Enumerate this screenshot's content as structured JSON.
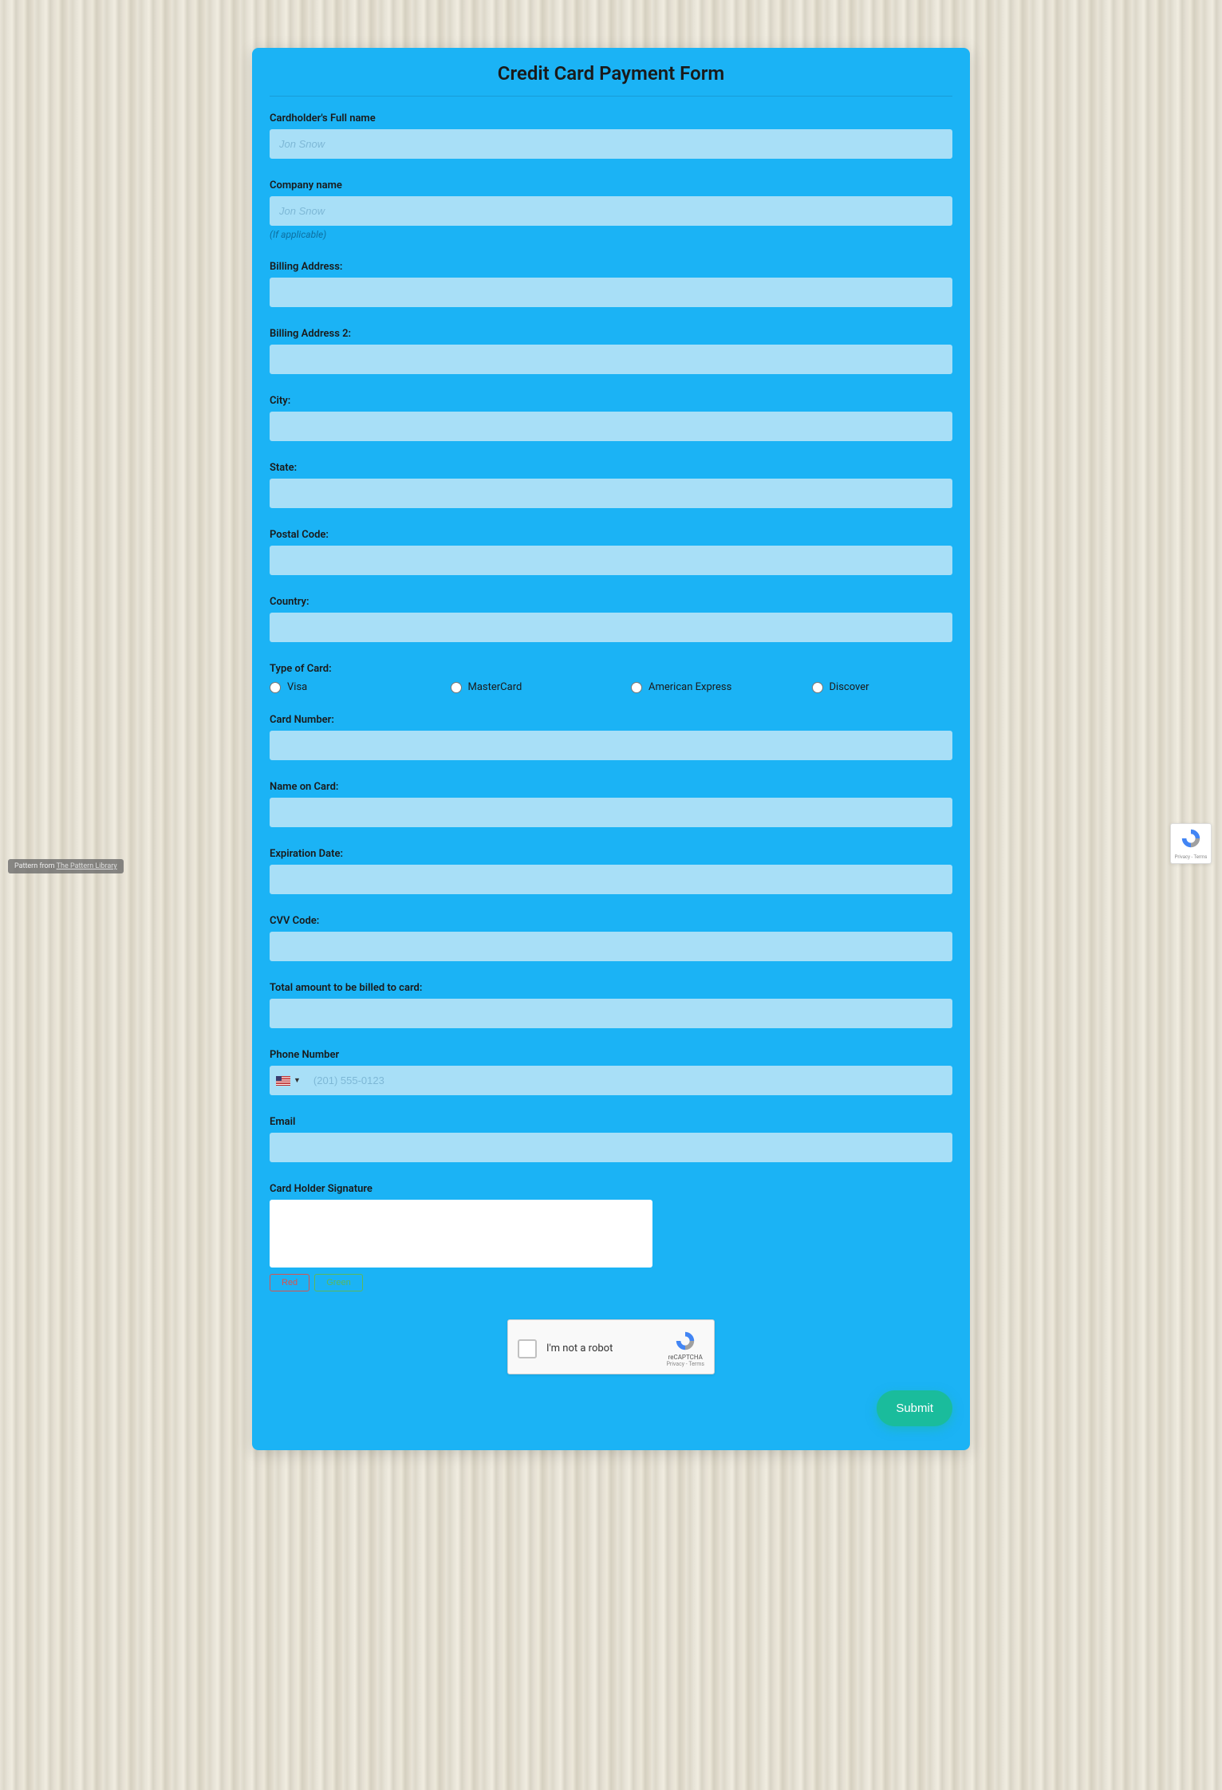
{
  "title": "Credit Card Payment Form",
  "fields": {
    "cardholder": {
      "label": "Cardholder's Full name",
      "placeholder": "Jon Snow"
    },
    "company": {
      "label": "Company name",
      "placeholder": "Jon Snow",
      "hint": "(If applicable)"
    },
    "billing1": {
      "label": "Billing Address:"
    },
    "billing2": {
      "label": "Billing Address 2:"
    },
    "city": {
      "label": "City:"
    },
    "state": {
      "label": "State:"
    },
    "postal": {
      "label": "Postal Code:"
    },
    "country": {
      "label": "Country:"
    },
    "cardtype": {
      "label": "Type of Card:",
      "options": [
        "Visa",
        "MasterCard",
        "American Express",
        "Discover"
      ]
    },
    "cardnumber": {
      "label": "Card Number:"
    },
    "nameoncard": {
      "label": "Name on Card:"
    },
    "expiration": {
      "label": "Expiration Date:"
    },
    "cvv": {
      "label": "CVV Code:"
    },
    "total": {
      "label": "Total amount to be billed to card:"
    },
    "phone": {
      "label": "Phone Number",
      "placeholder": "(201) 555-0123"
    },
    "email": {
      "label": "Email"
    },
    "signature": {
      "label": "Card Holder Signature",
      "btnRed": "Red",
      "btnGreen": "Green"
    }
  },
  "recaptcha": {
    "text": "I'm not a robot",
    "brand": "reCAPTCHA",
    "terms": "Privacy - Terms"
  },
  "submit": "Submit",
  "sideBadge": {
    "prefix": "Pattern from ",
    "link": "The Pattern Library"
  }
}
